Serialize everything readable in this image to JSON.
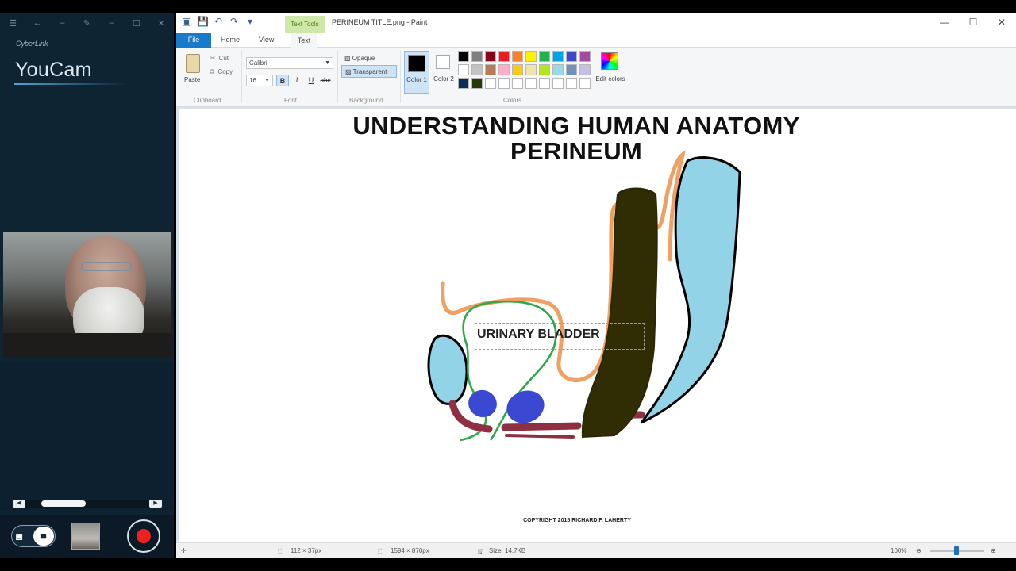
{
  "youcam": {
    "brand": "CyberLink",
    "app_name": "YouCam",
    "titlebar_icons": [
      "menu-icon",
      "back-icon",
      "pencil-icon",
      "minimize-icon",
      "restore-icon",
      "close-icon"
    ]
  },
  "paint": {
    "context_tab": "Text Tools",
    "window_title": "PERINEUM TITLE.png - Paint",
    "tabs": {
      "file": "File",
      "home": "Home",
      "view": "View",
      "text": "Text"
    },
    "clipboard": {
      "paste": "Paste",
      "cut": "Cut",
      "copy": "Copy",
      "group": "Clipboard"
    },
    "font": {
      "name": "Calibri",
      "size": "16",
      "bold": "B",
      "italic": "I",
      "underline": "U",
      "strike": "abc",
      "group": "Font"
    },
    "background": {
      "opaque": "Opaque",
      "transparent": "Transparent",
      "group": "Background"
    },
    "colors": {
      "color1": "Color 1",
      "color2": "Color 2",
      "edit": "Edit colors",
      "group": "Colors",
      "color1_value": "#000000",
      "color2_value": "#ffffff",
      "palette": [
        "#000000",
        "#7f7f7f",
        "#880015",
        "#ed1c24",
        "#ff7f27",
        "#fff200",
        "#22b14c",
        "#00a2e8",
        "#3f48cc",
        "#a349a4",
        "#ffffff",
        "#c3c3c3",
        "#b97a57",
        "#ffaec9",
        "#ffc90e",
        "#efe4b0",
        "#b5e61d",
        "#99d9ea",
        "#7092be",
        "#c8bfe7",
        "#0b2c58",
        "#243a08",
        "#ffffff",
        "#ffffff",
        "#ffffff",
        "#ffffff",
        "#ffffff",
        "#ffffff",
        "#ffffff",
        "#ffffff"
      ]
    },
    "canvas": {
      "title_line1": "UNDERSTANDING HUMAN ANATOMY",
      "title_line2": "PERINEUM",
      "label": "URINARY BLADDER",
      "copyright": "COPYRIGHT 2015 RICHARD F. LAHERTY"
    },
    "status": {
      "selection_size": "112 × 37px",
      "image_size": "1594 × 870px",
      "file_size": "Size: 14.7KB",
      "zoom": "100%",
      "zoom_value": 1.0
    }
  }
}
